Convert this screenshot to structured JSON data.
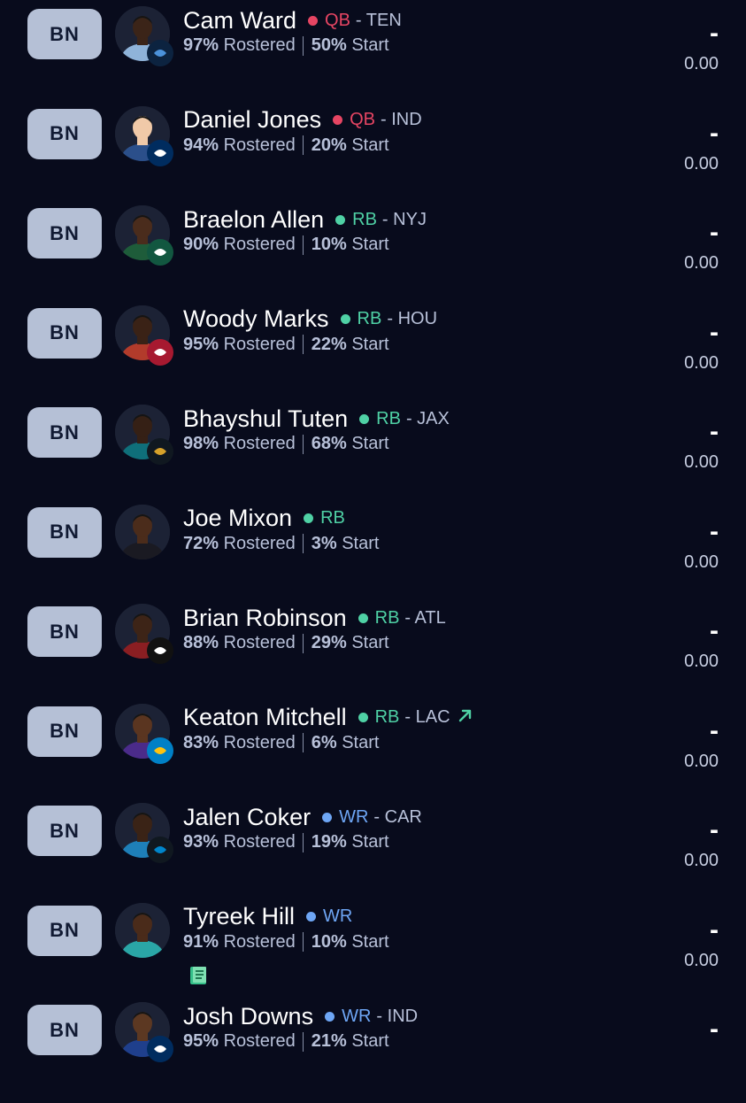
{
  "players": [
    {
      "slot": "BN",
      "name": "Cam Ward",
      "position": "QB",
      "team": "TEN",
      "pos_color": "#e64563",
      "rostered": "97%",
      "rostered_label": "Rostered",
      "start": "50%",
      "start_label": "Start",
      "proj": "-",
      "points": "0.00",
      "logo": "titans-logo-icon"
    },
    {
      "slot": "BN",
      "name": "Daniel Jones",
      "position": "QB",
      "team": "IND",
      "pos_color": "#e64563",
      "rostered": "94%",
      "rostered_label": "Rostered",
      "start": "20%",
      "start_label": "Start",
      "proj": "-",
      "points": "0.00",
      "logo": "colts-logo-icon"
    },
    {
      "slot": "BN",
      "name": "Braelon Allen",
      "position": "RB",
      "team": "NYJ",
      "pos_color": "#4fd1a5",
      "rostered": "90%",
      "rostered_label": "Rostered",
      "start": "10%",
      "start_label": "Start",
      "proj": "-",
      "points": "0.00",
      "logo": "jets-logo-icon"
    },
    {
      "slot": "BN",
      "name": "Woody Marks",
      "position": "RB",
      "team": "HOU",
      "pos_color": "#4fd1a5",
      "rostered": "95%",
      "rostered_label": "Rostered",
      "start": "22%",
      "start_label": "Start",
      "proj": "-",
      "points": "0.00",
      "logo": "texans-logo-icon"
    },
    {
      "slot": "BN",
      "name": "Bhayshul Tuten",
      "position": "RB",
      "team": "JAX",
      "pos_color": "#4fd1a5",
      "rostered": "98%",
      "rostered_label": "Rostered",
      "start": "68%",
      "start_label": "Start",
      "proj": "-",
      "points": "0.00",
      "logo": "jaguars-logo-icon"
    },
    {
      "slot": "BN",
      "name": "Joe Mixon",
      "position": "RB",
      "team": "",
      "pos_color": "#4fd1a5",
      "rostered": "72%",
      "rostered_label": "Rostered",
      "start": "3%",
      "start_label": "Start",
      "proj": "-",
      "points": "0.00",
      "logo": ""
    },
    {
      "slot": "BN",
      "name": "Brian Robinson",
      "position": "RB",
      "team": "ATL",
      "pos_color": "#4fd1a5",
      "rostered": "88%",
      "rostered_label": "Rostered",
      "start": "29%",
      "start_label": "Start",
      "proj": "-",
      "points": "0.00",
      "logo": "falcons-logo-icon"
    },
    {
      "slot": "BN",
      "name": "Keaton Mitchell",
      "position": "RB",
      "team": "LAC",
      "pos_color": "#4fd1a5",
      "rostered": "83%",
      "rostered_label": "Rostered",
      "start": "6%",
      "start_label": "Start",
      "proj": "-",
      "points": "0.00",
      "logo": "chargers-logo-icon",
      "trend": "trending-up-icon"
    },
    {
      "slot": "BN",
      "name": "Jalen Coker",
      "position": "WR",
      "team": "CAR",
      "pos_color": "#6ea6f5",
      "rostered": "93%",
      "rostered_label": "Rostered",
      "start": "19%",
      "start_label": "Start",
      "proj": "-",
      "points": "0.00",
      "logo": "panthers-logo-icon"
    },
    {
      "slot": "BN",
      "name": "Tyreek Hill",
      "position": "WR",
      "team": "",
      "pos_color": "#6ea6f5",
      "rostered": "91%",
      "rostered_label": "Rostered",
      "start": "10%",
      "start_label": "Start",
      "proj": "-",
      "points": "0.00",
      "logo": "",
      "note": "news-note-icon"
    },
    {
      "slot": "BN",
      "name": "Josh Downs",
      "position": "WR",
      "team": "IND",
      "pos_color": "#6ea6f5",
      "rostered": "95%",
      "rostered_label": "Rostered",
      "start": "21%",
      "start_label": "Start",
      "proj": "-",
      "points": "",
      "logo": "colts-logo-icon"
    }
  ],
  "team_separator": "-"
}
